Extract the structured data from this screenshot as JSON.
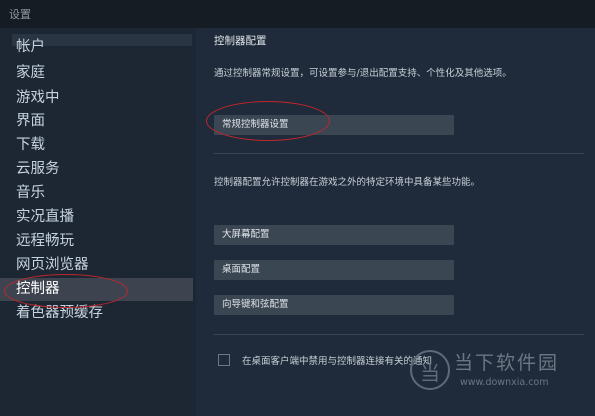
{
  "window": {
    "title": "设置"
  },
  "sidebar": {
    "items": [
      {
        "label": "帐户"
      },
      {
        "label": "家庭"
      },
      {
        "label": "游戏中"
      },
      {
        "label": "界面"
      },
      {
        "label": "下载"
      },
      {
        "label": "云服务"
      },
      {
        "label": "音乐"
      },
      {
        "label": "实况直播"
      },
      {
        "label": "远程畅玩"
      },
      {
        "label": "网页浏览器"
      },
      {
        "label": "控制器",
        "selected": true
      },
      {
        "label": "着色器预缓存"
      }
    ]
  },
  "main": {
    "section_title": "控制器配置",
    "general_description": "通过控制器常规设置，可设置参与/退出配置支持、个性化及其他选项。",
    "general_settings_button": "常规控制器设置",
    "config_description": "控制器配置允许控制器在游戏之外的特定环境中具备某些功能。",
    "buttons": [
      {
        "label": "大屏幕配置"
      },
      {
        "label": "桌面配置"
      },
      {
        "label": "向导键和弦配置"
      }
    ],
    "disable_checkbox": {
      "label": "在桌面客户端中禁用与控制器连接有关的通知",
      "checked": false
    }
  },
  "watermark": {
    "logo_glyph": "当",
    "name": "当下软件园",
    "url": "www.downxia.com"
  },
  "colors": {
    "annotation": "#c0272d",
    "selected_item": "#3d4450",
    "button": "#3b4653"
  }
}
